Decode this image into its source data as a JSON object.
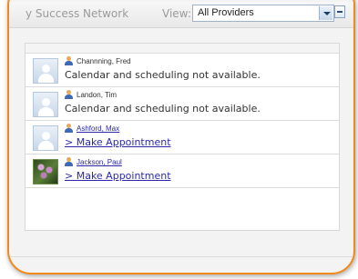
{
  "header": {
    "title": "y Success Network",
    "view_label": "View:",
    "view_select": {
      "selected": "All Providers"
    }
  },
  "providers": [
    {
      "name": "Channning, Fred",
      "name_is_link": false,
      "status": "Calendar and scheduling not available.",
      "avatar": "placeholder"
    },
    {
      "name": "Landon, Tim",
      "name_is_link": false,
      "status": "Calendar and scheduling not available.",
      "avatar": "placeholder"
    },
    {
      "name": "Ashford, Max",
      "name_is_link": true,
      "action": "> Make Appointment",
      "avatar": "placeholder"
    },
    {
      "name": "Jackson, Paul",
      "name_is_link": true,
      "action": "> Make Appointment",
      "avatar": "photo"
    }
  ],
  "icons": {
    "select_arrow": "chevron-down-icon",
    "minimize": "minimize-icon",
    "person": "person-icon",
    "avatar_placeholder": "avatar-placeholder-icon"
  },
  "colors": {
    "frame_border": "#f08a1c",
    "link": "#2a2aa8"
  }
}
